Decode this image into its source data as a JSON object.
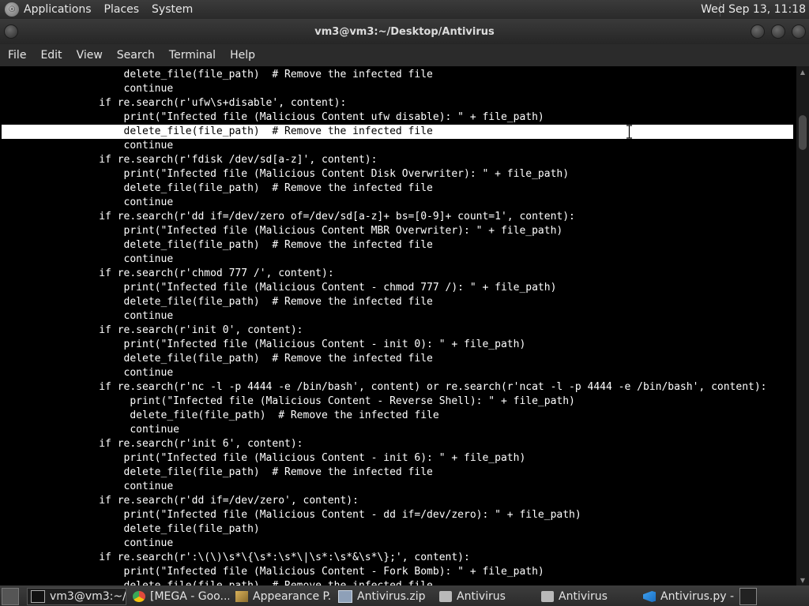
{
  "top_panel": {
    "menus": [
      "Applications",
      "Places",
      "System"
    ],
    "clock": "Wed Sep 13, 11:18"
  },
  "window": {
    "title": "vm3@vm3:~/Desktop/Antivirus"
  },
  "menubar": [
    "File",
    "Edit",
    "View",
    "Search",
    "Terminal",
    "Help"
  ],
  "terminal": {
    "highlighted_line_index": 4,
    "lines": [
      "                    delete_file(file_path)  # Remove the infected file",
      "                    continue",
      "                if re.search(r'ufw\\s+disable', content):",
      "                    print(\"Infected file (Malicious Content ufw disable): \" + file_path)",
      "                    delete_file(file_path)  # Remove the infected file",
      "                    continue",
      "                if re.search(r'fdisk /dev/sd[a-z]', content):",
      "                    print(\"Infected file (Malicious Content Disk Overwriter): \" + file_path)",
      "                    delete_file(file_path)  # Remove the infected file",
      "                    continue",
      "                if re.search(r'dd if=/dev/zero of=/dev/sd[a-z]+ bs=[0-9]+ count=1', content):",
      "                    print(\"Infected file (Malicious Content MBR Overwriter): \" + file_path)",
      "                    delete_file(file_path)  # Remove the infected file",
      "                    continue",
      "                if re.search(r'chmod 777 /', content):",
      "                    print(\"Infected file (Malicious Content - chmod 777 /): \" + file_path)",
      "                    delete_file(file_path)  # Remove the infected file",
      "                    continue",
      "                if re.search(r'init 0', content):",
      "                    print(\"Infected file (Malicious Content - init 0): \" + file_path)",
      "                    delete_file(file_path)  # Remove the infected file",
      "                    continue",
      "                if re.search(r'nc -l -p 4444 -e /bin/bash', content) or re.search(r'ncat -l -p 4444 -e /bin/bash', content):",
      "                     print(\"Infected file (Malicious Content - Reverse Shell): \" + file_path)",
      "                     delete_file(file_path)  # Remove the infected file",
      "                     continue",
      "                if re.search(r'init 6', content):",
      "                    print(\"Infected file (Malicious Content - init 6): \" + file_path)",
      "                    delete_file(file_path)  # Remove the infected file",
      "                    continue",
      "                if re.search(r'dd if=/dev/zero', content):",
      "                    print(\"Infected file (Malicious Content - dd if=/dev/zero): \" + file_path)",
      "                    delete_file(file_path)",
      "                    continue",
      "                if re.search(r':\\(\\)\\s*\\{\\s*:\\s*\\|\\s*:\\s*&\\s*\\};', content):",
      "                    print(\"Infected file (Malicious Content - Fork Bomb): \" + file_path)",
      "                    delete_file(file_path)  # Remove the infected file"
    ]
  },
  "taskbar": {
    "tasks": [
      {
        "label": "vm3@vm3:~/...",
        "icon": "terminal-icon",
        "active": true
      },
      {
        "label": "[MEGA - Goo...",
        "icon": "chrome-icon",
        "active": false
      },
      {
        "label": "Appearance P...",
        "icon": "appearance-icon",
        "active": false
      },
      {
        "label": "Antivirus.zip",
        "icon": "archive-icon",
        "active": false
      },
      {
        "label": "Antivirus",
        "icon": "folder-icon",
        "active": false
      },
      {
        "label": "Antivirus",
        "icon": "folder-icon",
        "active": false
      },
      {
        "label": "Antivirus.py - ...",
        "icon": "vscode-icon",
        "active": false
      }
    ]
  }
}
